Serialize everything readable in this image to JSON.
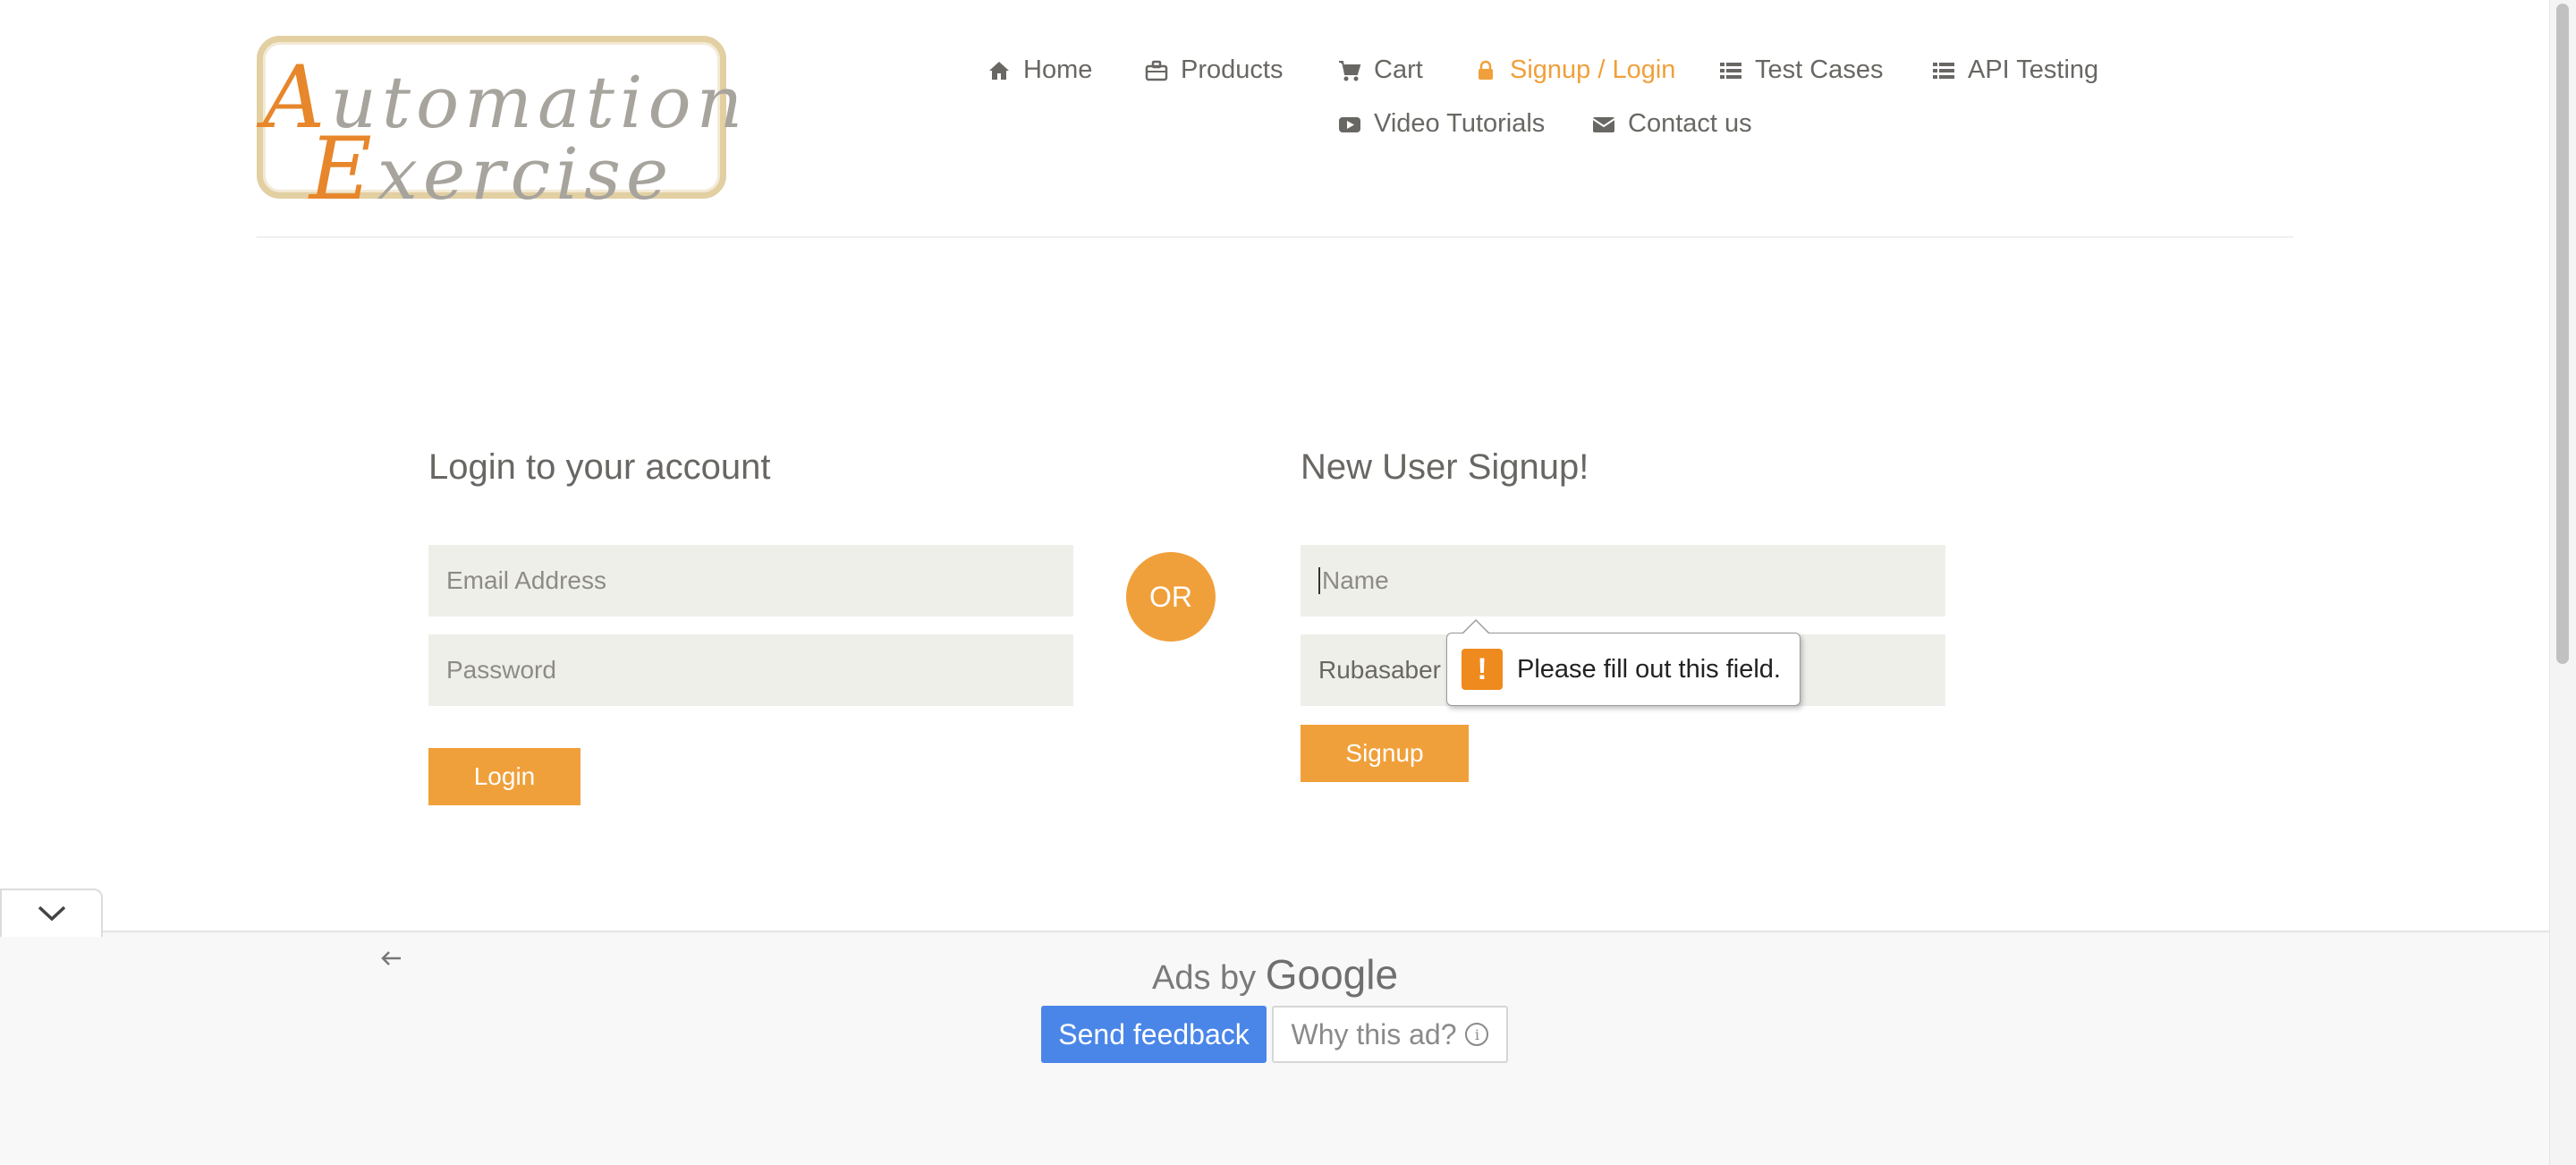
{
  "logo": {
    "line1": "Automation",
    "line2": "Exercise"
  },
  "nav": {
    "items": [
      {
        "label": "Home",
        "icon": "home-icon"
      },
      {
        "label": "Products",
        "icon": "briefcase-icon"
      },
      {
        "label": "Cart",
        "icon": "cart-icon"
      },
      {
        "label": "Signup / Login",
        "icon": "lock-icon",
        "active": true
      },
      {
        "label": "Test Cases",
        "icon": "list-icon"
      },
      {
        "label": "API Testing",
        "icon": "list-icon"
      },
      {
        "label": "Video Tutorials",
        "icon": "youtube-icon"
      },
      {
        "label": "Contact us",
        "icon": "envelope-icon"
      }
    ],
    "active_color": "#f0a03a"
  },
  "login": {
    "title": "Login to your account",
    "email_placeholder": "Email Address",
    "password_placeholder": "Password",
    "button": "Login"
  },
  "divider": {
    "or": "OR"
  },
  "signup": {
    "title": "New User Signup!",
    "name_placeholder": "Name",
    "email_value": "Rubasaber",
    "button": "Signup"
  },
  "validation": {
    "message": "Please fill out this field.",
    "icon": "warning-icon"
  },
  "ad": {
    "ads_by": "Ads by",
    "google": "Google",
    "send_feedback": "Send feedback",
    "why_this_ad": "Why this ad?",
    "back_icon": "arrow-left-icon",
    "collapse_icon": "chevron-down-icon"
  },
  "colors": {
    "accent": "#f0a03a",
    "field_bg": "#efefea",
    "text": "#696763",
    "ad_blue": "#4a86e8"
  }
}
